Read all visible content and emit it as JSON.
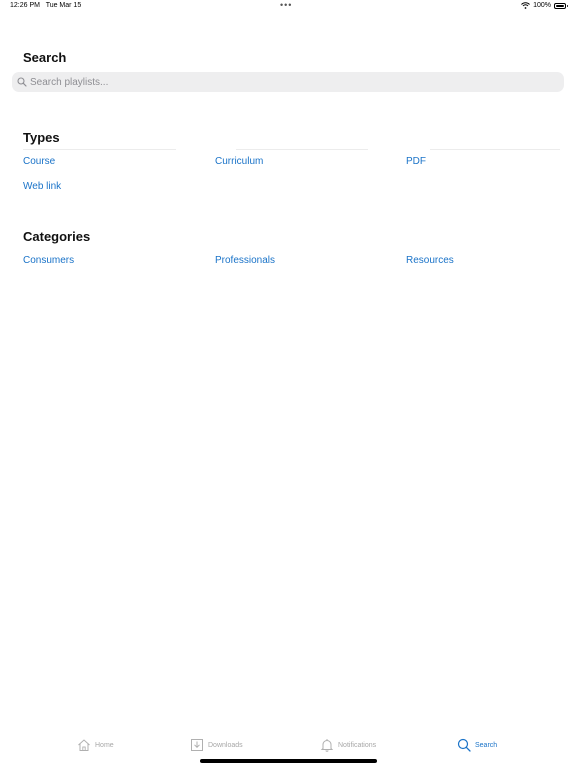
{
  "status": {
    "time": "12:26 PM",
    "date": "Tue Mar 15",
    "battery": "100%"
  },
  "search": {
    "title": "Search",
    "placeholder": "Search playlists..."
  },
  "types": {
    "title": "Types",
    "items": [
      "Course",
      "Curriculum",
      "PDF",
      "Web link"
    ]
  },
  "categories": {
    "title": "Categories",
    "items": [
      "Consumers",
      "Professionals",
      "Resources"
    ]
  },
  "tabs": [
    {
      "label": "Home",
      "icon": "home-icon"
    },
    {
      "label": "Downloads",
      "icon": "download-icon"
    },
    {
      "label": "Notifications",
      "icon": "bell-icon"
    },
    {
      "label": "Search",
      "icon": "search-icon",
      "active": true
    }
  ],
  "colors": {
    "accent": "#1a73c8",
    "inactive_tab": "#a7a7a7",
    "search_bg": "#eeeeef"
  }
}
